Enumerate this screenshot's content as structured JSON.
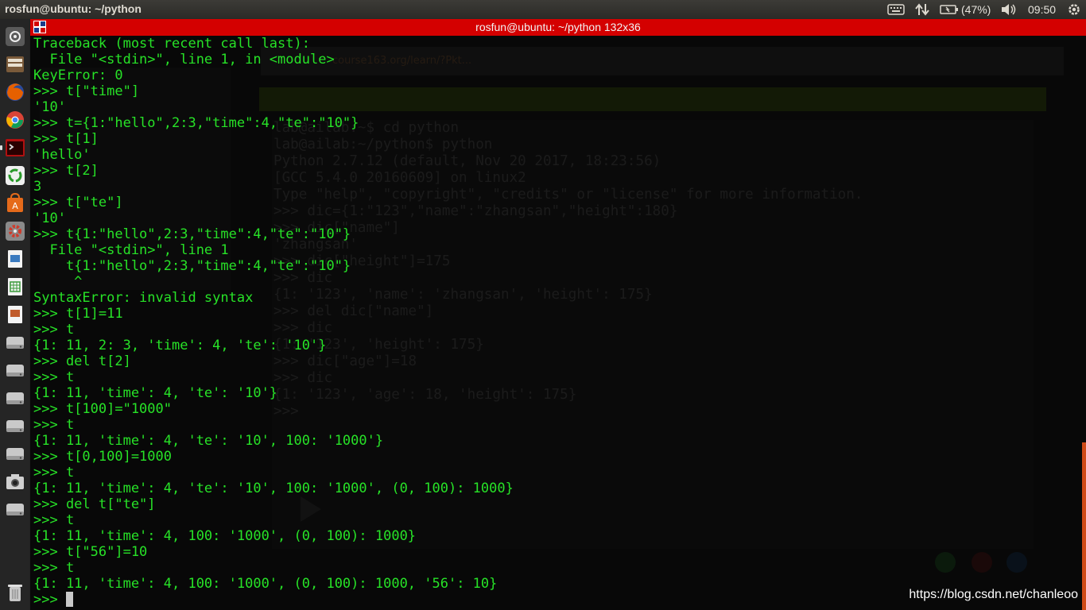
{
  "top_panel": {
    "title": "rosfun@ubuntu: ~/python",
    "battery": "(47%)",
    "clock": "09:50"
  },
  "launcher": {
    "items": [
      {
        "name": "dash-home-icon",
        "color": "#6a6a6a"
      },
      {
        "name": "files-icon",
        "color": "#8a6a4a"
      },
      {
        "name": "firefox-icon",
        "color": "#e66000"
      },
      {
        "name": "chrome-icon",
        "color": "#4285f4"
      },
      {
        "name": "terminal-icon",
        "color": "#b01010"
      },
      {
        "name": "sync-icon",
        "color": "#2a9a2a"
      },
      {
        "name": "software-center-icon",
        "color": "#e56a1a"
      },
      {
        "name": "system-settings-icon",
        "color": "#d03a2a"
      },
      {
        "name": "document-viewer-icon",
        "color": "#3a7abf"
      },
      {
        "name": "spreadsheet-icon",
        "color": "#3a9a3a"
      },
      {
        "name": "presentation-icon",
        "color": "#c05a2a"
      },
      {
        "name": "drive-icon",
        "color": "#9a9a9a"
      },
      {
        "name": "drive-icon",
        "color": "#9a9a9a"
      },
      {
        "name": "drive-icon",
        "color": "#9a9a9a"
      },
      {
        "name": "drive-icon",
        "color": "#9a9a9a"
      },
      {
        "name": "drive-icon",
        "color": "#9a9a9a"
      },
      {
        "name": "camera-icon",
        "color": "#9a9a9a"
      },
      {
        "name": "drive-icon",
        "color": "#9a9a9a"
      },
      {
        "name": "trash-icon",
        "color": "#9a9a9a"
      }
    ]
  },
  "terminal": {
    "title": "rosfun@ubuntu: ~/python 132x36",
    "text_color": "#27e227",
    "title_bar_color": "#d40000",
    "lines": [
      "Traceback (most recent call last):",
      "  File \"<stdin>\", line 1, in <module>",
      "KeyError: 0",
      ">>> t[\"time\"]",
      "'10'",
      ">>> t={1:\"hello\",2:3,\"time\":4,\"te\":\"10\"}",
      ">>> t[1]",
      "'hello'",
      ">>> t[2]",
      "3",
      ">>> t[\"te\"]",
      "'10'",
      ">>> t{1:\"hello\",2:3,\"time\":4,\"te\":\"10\"}",
      "  File \"<stdin>\", line 1",
      "    t{1:\"hello\",2:3,\"time\":4,\"te\":\"10\"}",
      "     ^",
      "SyntaxError: invalid syntax",
      ">>> t[1]=11",
      ">>> t",
      "{1: 11, 2: 3, 'time': 4, 'te': '10'}",
      ">>> del t[2]",
      ">>> t",
      "{1: 11, 'time': 4, 'te': '10'}",
      ">>> t[100]=\"1000\"",
      ">>> t",
      "{1: 11, 'time': 4, 'te': '10', 100: '1000'}",
      ">>> t[0,100]=1000",
      ">>> t",
      "{1: 11, 'time': 4, 'te': '10', 100: '1000', (0, 100): 1000}",
      ">>> del t[\"te\"]",
      ">>> t",
      "{1: 11, 'time': 4, 100: '1000', (0, 100): 1000}",
      ">>> t[\"56\"]=10",
      ">>> t",
      "{1: 11, 'time': 4, 100: '1000', (0, 100): 1000, '56': 10}"
    ],
    "prompt": ">>> "
  },
  "background_window": {
    "url": "course163.org/learn/?Pkt...",
    "lines": [
      "lab@ailab:~$ cd python",
      "lab@ailab:~/python$ python",
      "Python 2.7.12 (default, Nov 20 2017, 18:23:56)",
      "[GCC 5.4.0 20160609] on linux2",
      "Type \"help\", \"copyright\", \"credits\" or \"license\" for more information.",
      ">>> dic={1:\"123\",\"name\":\"zhangsan\",\"height\":180}",
      ">>> dic[\"name\"]",
      "'zhangsan'",
      ">>> dic[\"height\"]=175",
      ">>> dic",
      "{1: '123', 'name': 'zhangsan', 'height': 175}",
      ">>> del dic[\"name\"]",
      ">>> dic",
      "{1: '123', 'height': 175}",
      ">>> dic[\"age\"]=18",
      ">>> dic",
      "{1: '123', 'age': 18, 'height': 175}",
      ">>>"
    ]
  },
  "watermark": "https://blog.csdn.net/chanleoo"
}
